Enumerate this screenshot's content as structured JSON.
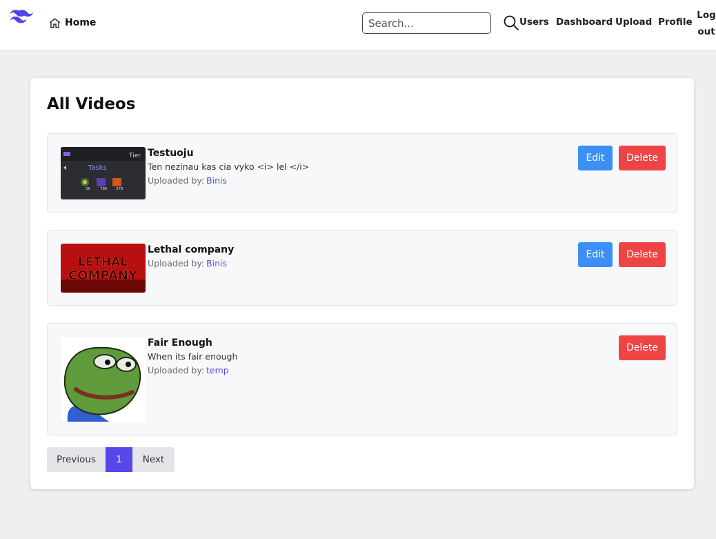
{
  "nav": {
    "home_label": "Home",
    "search_placeholder": "Search...",
    "links": {
      "users": "Users",
      "dashboard": "Dashboard",
      "upload": "Upload",
      "profile": "Profile",
      "logout_line1": "Log",
      "logout_line2": "out"
    },
    "icons": [
      "logo-icon",
      "home-icon",
      "search-icon"
    ]
  },
  "page": {
    "title": "All Videos"
  },
  "uploaded_by_label": "Uploaded by:",
  "videos": [
    {
      "title": "Testuoju",
      "description": "Ten nezinau kas cia vyko <i> lel </i>",
      "uploader": "Binis",
      "thumbnail": {
        "label": "Tasks",
        "corner_text": "Tier",
        "counts": [
          "36",
          "786",
          "378"
        ]
      },
      "actions": [
        "Edit",
        "Delete"
      ]
    },
    {
      "title": "Lethal company",
      "description": "",
      "uploader": "Binis",
      "thumbnail": {
        "line1": "LETHAL",
        "line2": "COMPANY"
      },
      "actions": [
        "Edit",
        "Delete"
      ]
    },
    {
      "title": "Fair Enough",
      "description": "When its fair enough",
      "uploader": "temp",
      "actions": [
        "Delete"
      ]
    }
  ],
  "pagination": {
    "previous": "Previous",
    "current": "1",
    "next": "Next"
  },
  "colors": {
    "accent": "#5647e8",
    "edit": "#3b8ff7",
    "delete": "#ee4444",
    "link": "#5b4fe0"
  }
}
